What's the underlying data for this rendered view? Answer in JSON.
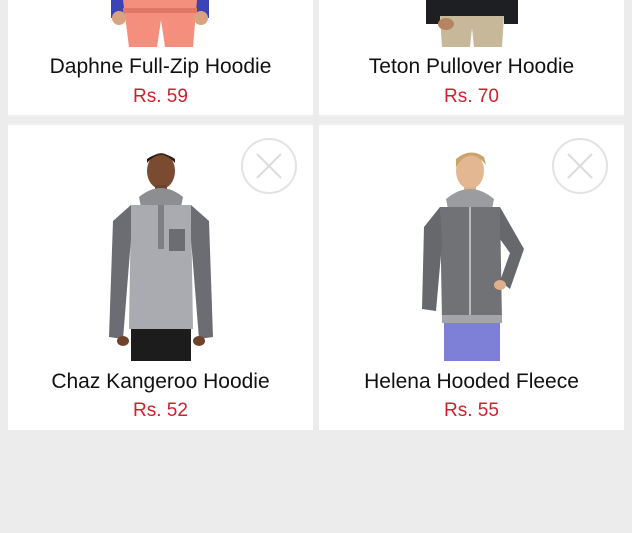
{
  "products": [
    {
      "name": "Daphne Full-Zip Hoodie",
      "price": "Rs. 59",
      "image_icon": "hoodie-woman-image"
    },
    {
      "name": "Teton Pullover Hoodie",
      "price": "Rs. 70",
      "image_icon": "hoodie-man-image"
    },
    {
      "name": "Chaz Kangeroo Hoodie",
      "price": "Rs. 52",
      "image_icon": "hoodie-man-image"
    },
    {
      "name": "Helena Hooded Fleece",
      "price": "Rs. 55",
      "image_icon": "hoodie-woman-image"
    }
  ],
  "remove_icon": "close-circle-icon",
  "colors": {
    "price": "#d0202e",
    "background": "#ececec",
    "card": "#ffffff"
  }
}
